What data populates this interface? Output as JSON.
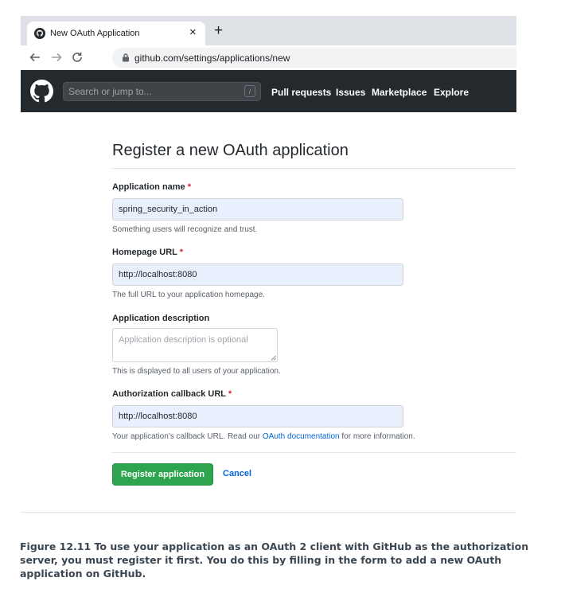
{
  "browser": {
    "tab_title": "New OAuth Application",
    "tab_close": "×",
    "new_tab": "+",
    "url": "github.com/settings/applications/new"
  },
  "github_header": {
    "search_placeholder": "Search or jump to...",
    "search_shortcut": "/",
    "nav": [
      "Pull requests",
      "Issues",
      "Marketplace",
      "Explore"
    ]
  },
  "form": {
    "title": "Register a new OAuth application",
    "required_marker": "*",
    "app_name": {
      "label": "Application name",
      "value": "spring_security_in_action",
      "note": "Something users will recognize and trust."
    },
    "homepage": {
      "label": "Homepage URL",
      "value": "http://localhost:8080",
      "note": "The full URL to your application homepage."
    },
    "description": {
      "label": "Application description",
      "placeholder": "Application description is optional",
      "note": "This is displayed to all users of your application."
    },
    "callback": {
      "label": "Authorization callback URL",
      "value": "http://localhost:8080",
      "note_before": "Your application's callback URL. Read our ",
      "note_link": "OAuth documentation",
      "note_after": " for more information."
    },
    "register_button": "Register application",
    "cancel_button": "Cancel"
  },
  "caption": {
    "lines": [
      "Figure 12.11   To use your application as an OAuth 2 client with GitHub as the authorization",
      "server, you must register it first. You do this by filling in the form to add a new OAuth",
      "application on GitHub."
    ]
  },
  "colors": {
    "header_bg": "#24292e",
    "register_green": "#2ea44f",
    "link_blue": "#0366d6",
    "required_red": "#cb2431",
    "autofill_bg": "#e8f0fe"
  }
}
